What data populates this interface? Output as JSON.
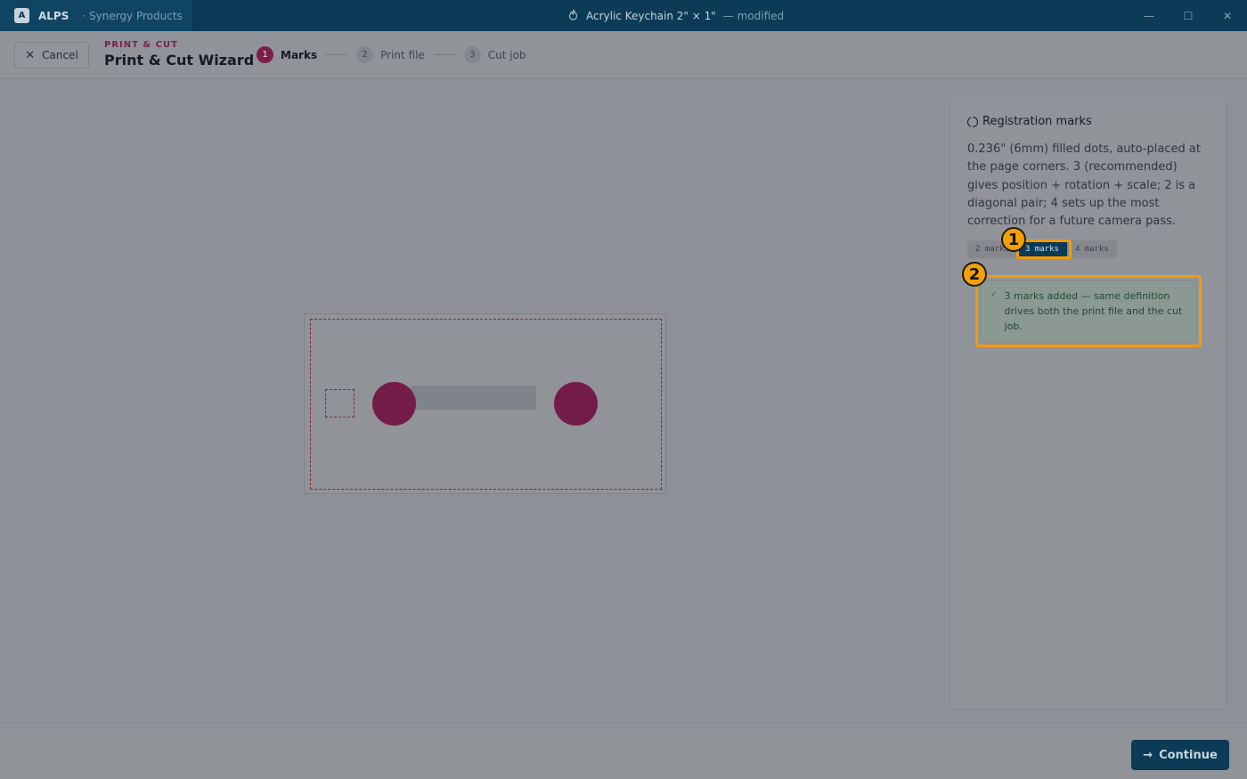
{
  "titlebar": {
    "logo_letter": "A",
    "app_name": "ALPS",
    "workspace": "· Synergy Products",
    "document": "Acrylic Keychain 2\" × 1\"",
    "modified": "— modified",
    "controls": {
      "minimize": "—",
      "maximize": "☐",
      "close": "✕"
    }
  },
  "header": {
    "cancel_label": "Cancel",
    "eyebrow": "PRINT & CUT",
    "title": "Print & Cut Wizard",
    "steps": [
      {
        "num": "1",
        "label": "Marks",
        "active": true
      },
      {
        "num": "2",
        "label": "Print file",
        "active": false
      },
      {
        "num": "3",
        "label": "Cut job",
        "active": false
      }
    ]
  },
  "panel": {
    "heading": "Registration marks",
    "description": "0.236\" (6mm) filled dots, auto-placed at the page corners. 3 (recommended) gives position + rotation + scale; 2 is a diagonal pair; 4 sets up the most correction for a future camera pass.",
    "options": [
      "2 marks",
      "3 marks",
      "4 marks"
    ],
    "selected_option": "3 marks",
    "notice": "3 marks added — same definition drives both the print file and the cut job."
  },
  "footer": {
    "continue_label": "Continue"
  },
  "annotations": [
    "1",
    "2"
  ],
  "colors": {
    "titlebar": "#0b3b56",
    "brand": "#7b1d4a",
    "registration_dot": "#731c48",
    "safe_area_line": "#8a2430",
    "callout": "#f59b00"
  },
  "icons": {
    "cancel": "close-icon",
    "document": "flame-icon",
    "panel_heading": "crosshair-icon",
    "notice": "check-icon",
    "continue": "arrow-right-icon"
  }
}
